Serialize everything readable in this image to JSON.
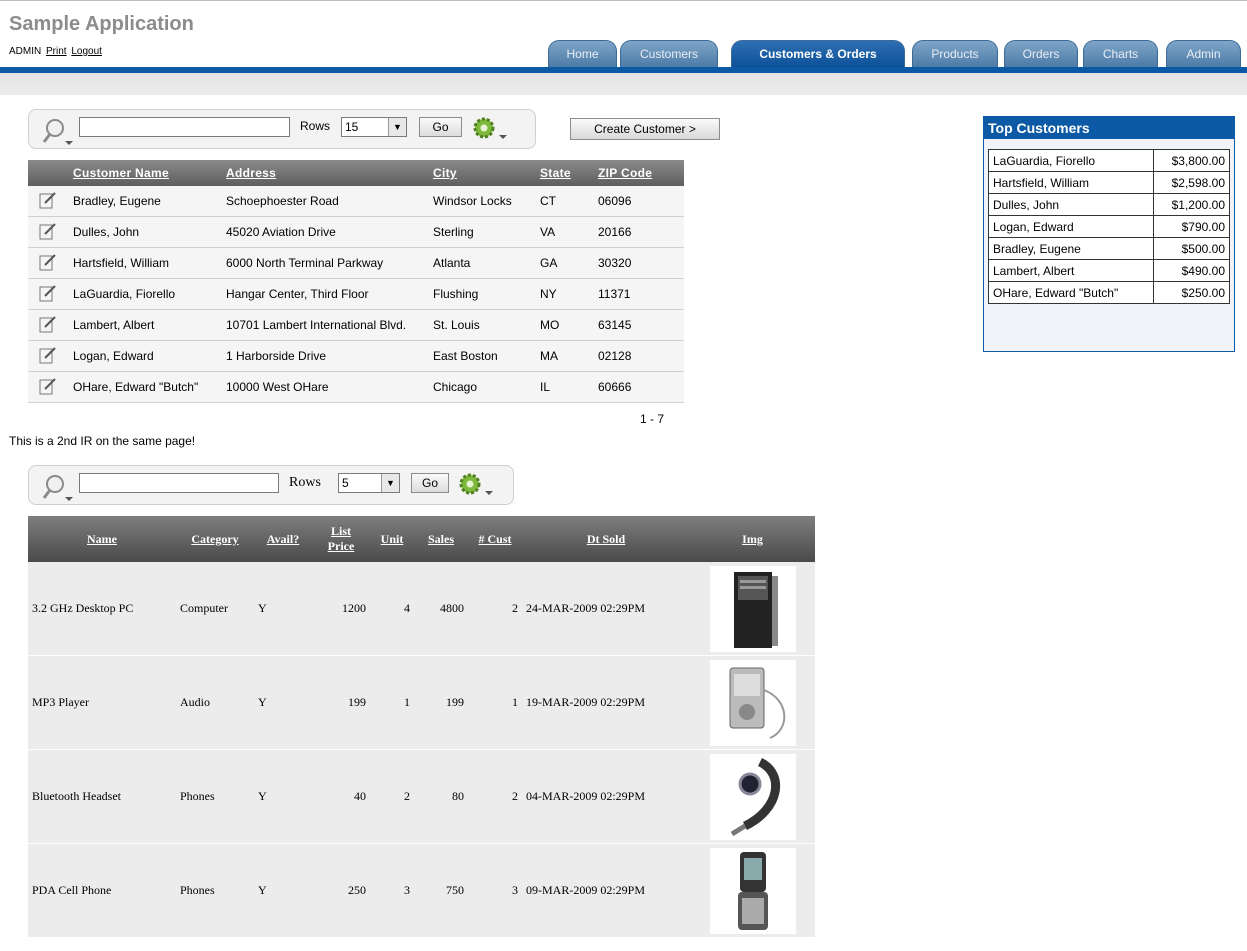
{
  "app": {
    "title": "Sample Application",
    "user": "ADMIN",
    "print_link": "Print",
    "logout_link": "Logout"
  },
  "tabs": [
    {
      "label": "Home",
      "active": false
    },
    {
      "label": "Customers",
      "active": false
    },
    {
      "label": "Customers & Orders",
      "active": true
    },
    {
      "label": "Products",
      "active": false
    },
    {
      "label": "Orders",
      "active": false
    },
    {
      "label": "Charts",
      "active": false
    },
    {
      "label": "Admin",
      "active": false
    }
  ],
  "customers_report": {
    "search_value": "",
    "rows_label": "Rows",
    "rows_value": "15",
    "go_label": "Go",
    "create_button": "Create Customer >",
    "columns": [
      "Customer Name",
      "Address",
      "City",
      "State",
      "ZIP Code"
    ],
    "rows": [
      [
        "Bradley, Eugene",
        "Schoephoester Road",
        "Windsor Locks",
        "CT",
        "06096"
      ],
      [
        "Dulles, John",
        "45020 Aviation Drive",
        "Sterling",
        "VA",
        "20166"
      ],
      [
        "Hartsfield, William",
        "6000 North Terminal Parkway",
        "Atlanta",
        "GA",
        "30320"
      ],
      [
        "LaGuardia, Fiorello",
        "Hangar Center, Third Floor",
        "Flushing",
        "NY",
        "11371"
      ],
      [
        "Lambert, Albert",
        "10701 Lambert International Blvd.",
        "St. Louis",
        "MO",
        "63145"
      ],
      [
        "Logan, Edward",
        "1 Harborside Drive",
        "East Boston",
        "MA",
        "02128"
      ],
      [
        "OHare, Edward \"Butch\"",
        "10000 West OHare",
        "Chicago",
        "IL",
        "60666"
      ]
    ],
    "pagination": "1 - 7"
  },
  "second_ir_note": "This is a 2nd IR on the same page!",
  "products_report": {
    "search_value": "",
    "rows_label": "Rows",
    "rows_value": "5",
    "go_label": "Go",
    "columns": {
      "name": "Name",
      "category": "Category",
      "avail": "Avail?",
      "list_price_1": "List",
      "list_price_2": "Price",
      "unit": "Unit",
      "sales": "Sales",
      "cust": "# Cust",
      "dt_sold": "Dt Sold",
      "img": "Img"
    },
    "rows": [
      {
        "name": "3.2 GHz Desktop PC",
        "category": "Computer",
        "avail": "Y",
        "price": "1200",
        "unit": "4",
        "sales": "4800",
        "cust": "2",
        "dt": "24-MAR-2009 02:29PM",
        "img": "desktop-pc-image"
      },
      {
        "name": "MP3 Player",
        "category": "Audio",
        "avail": "Y",
        "price": "199",
        "unit": "1",
        "sales": "199",
        "cust": "1",
        "dt": "19-MAR-2009 02:29PM",
        "img": "mp3-player-image"
      },
      {
        "name": "Bluetooth Headset",
        "category": "Phones",
        "avail": "Y",
        "price": "40",
        "unit": "2",
        "sales": "80",
        "cust": "2",
        "dt": "04-MAR-2009 02:29PM",
        "img": "headset-image"
      },
      {
        "name": "PDA Cell Phone",
        "category": "Phones",
        "avail": "Y",
        "price": "250",
        "unit": "3",
        "sales": "750",
        "cust": "3",
        "dt": "09-MAR-2009 02:29PM",
        "img": "cell-phone-image"
      }
    ]
  },
  "top_customers": {
    "title": "Top Customers",
    "rows": [
      [
        "LaGuardia, Fiorello",
        "$3,800.00"
      ],
      [
        "Hartsfield, William",
        "$2,598.00"
      ],
      [
        "Dulles, John",
        "$1,200.00"
      ],
      [
        "Logan, Edward",
        "$790.00"
      ],
      [
        "Bradley, Eugene",
        "$500.00"
      ],
      [
        "Lambert, Albert",
        "$490.00"
      ],
      [
        "OHare, Edward \"Butch\"",
        "$250.00"
      ]
    ]
  },
  "colors": {
    "brand_blue": "#0c5aa6",
    "header_grey": "#5e5e5e"
  }
}
